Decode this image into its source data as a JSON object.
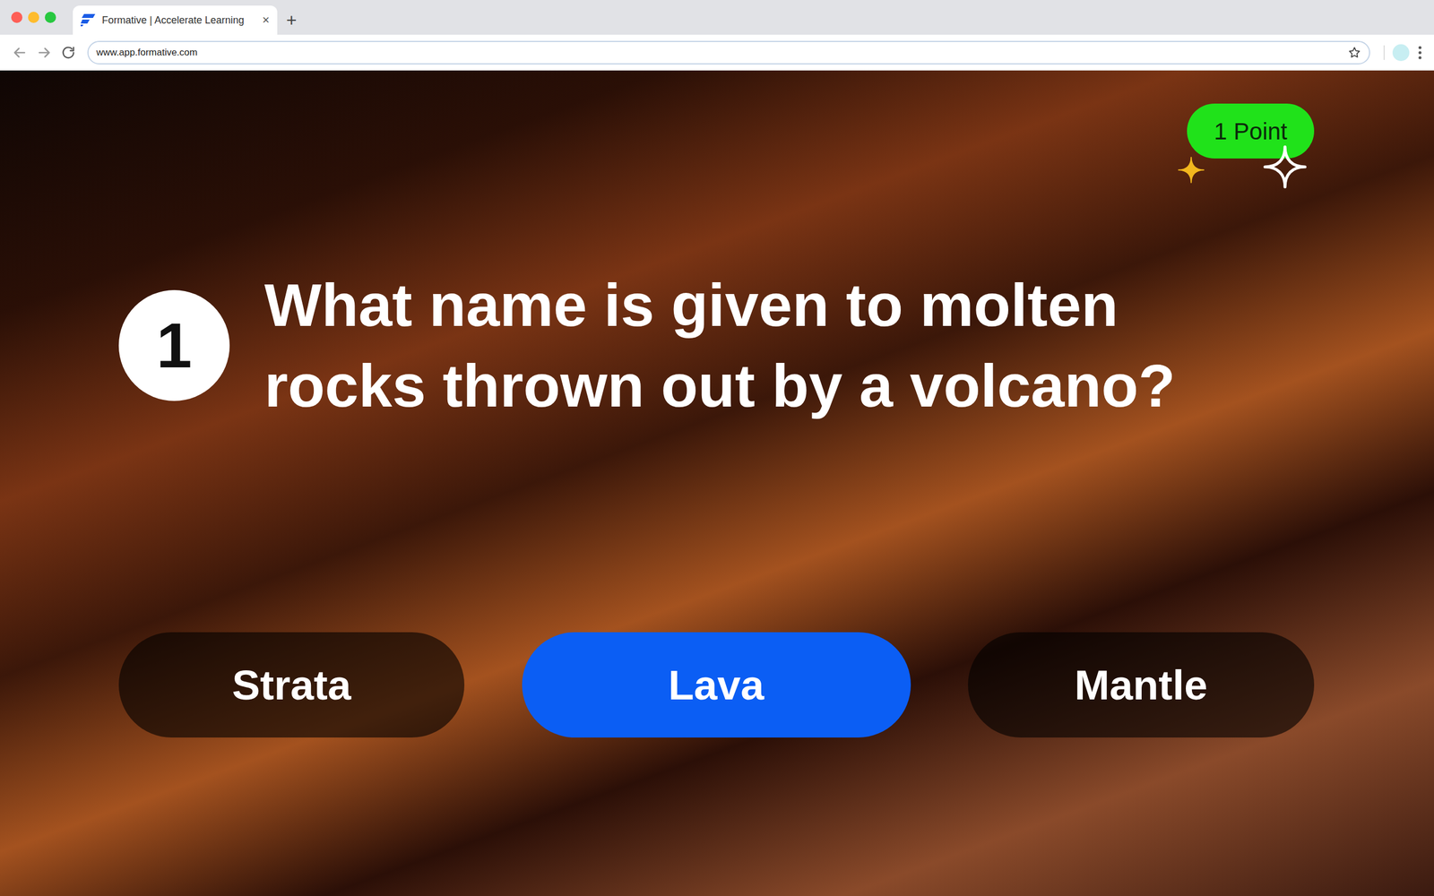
{
  "window": {
    "title": "Formative | Accelerate Learning",
    "url": "www.app.formative.com",
    "tab_close": "×",
    "new_tab": "+"
  },
  "badge": "1 Point",
  "question": {
    "number": "1",
    "text": "What name is given to molten rocks thrown out by a volcano?"
  },
  "answers": [
    {
      "label": "Strata",
      "selected": false
    },
    {
      "label": "Lava",
      "selected": true
    },
    {
      "label": "Mantle",
      "selected": false
    }
  ]
}
